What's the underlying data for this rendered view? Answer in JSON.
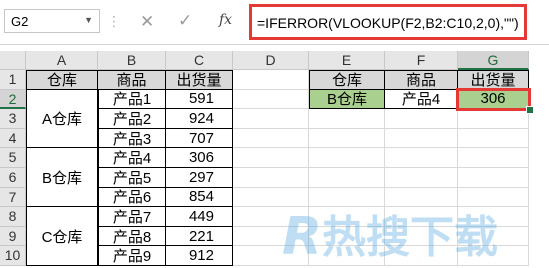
{
  "namebox": {
    "value": "G2"
  },
  "formula_bar": {
    "formula": "=IFERROR(VLOOKUP(F2,B2:C10,2,0),\"\")",
    "fx": "fx"
  },
  "columns": [
    "A",
    "B",
    "C",
    "D",
    "E",
    "F",
    "G"
  ],
  "rows": [
    "1",
    "2",
    "3",
    "4",
    "5",
    "6",
    "7",
    "8",
    "9",
    "10"
  ],
  "table": {
    "headers": [
      "仓库",
      "商品",
      "出货量"
    ],
    "groups": [
      "A仓库",
      "B仓库",
      "C仓库"
    ],
    "products": [
      "产品1",
      "产品2",
      "产品3",
      "产品4",
      "产品5",
      "产品6",
      "产品7",
      "产品8",
      "产品9"
    ],
    "quantities": [
      "591",
      "924",
      "707",
      "306",
      "297",
      "854",
      "449",
      "221",
      "912"
    ]
  },
  "lookup": {
    "headers": [
      "仓库",
      "商品",
      "出货量"
    ],
    "warehouse": "B仓库",
    "product": "产品4",
    "result": "306"
  },
  "colors": {
    "highlight_red": "#e53935",
    "header_gray": "#d8d8d8",
    "lookup_green": "#a9d08e",
    "excel_green": "#217346"
  },
  "watermark": "热搜下载"
}
